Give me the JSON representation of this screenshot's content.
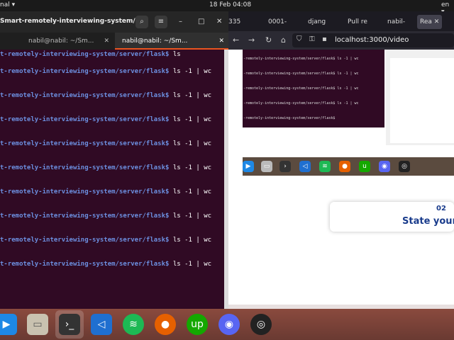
{
  "topbar": {
    "app": "nal ▾",
    "clock": "18 Feb 04:08",
    "lang": "en ▾"
  },
  "terminal": {
    "title": "Smart-remotely-interviewing-system/...",
    "tabs": [
      {
        "label": "nabil@nabil: ~/Sm..."
      },
      {
        "label": "nabil@nabil: ~/Sm..."
      }
    ],
    "prompt_path": "t-remotely-interviewing-system/server/flask$",
    "lines": [
      " ls",
      " ls -1 | wc",
      " ls -1 | wc",
      " ls -1 | wc",
      " ls -1 | wc",
      " ls -1 | wc",
      " ls -1 | wc",
      " ls -1 | wc",
      " ls -1 | wc",
      " ls -1 | wc"
    ]
  },
  "browser": {
    "tabs": [
      "335",
      "0001-",
      "djang",
      "Pull re",
      "nabil-",
      "Rea"
    ],
    "url": "localhost:3000/video",
    "embed_lines": [
      "-remotely-interviewing-system/server/flask$ ls -1 | wc",
      "-remotely-interviewing-system/server/flask$ ls -1 | wc",
      "-remotely-interviewing-system/server/flask$ ls -1 | wc",
      "-remotely-interviewing-system/server/flask$ ls -1 | wc",
      "-remotely-interviewing-system/server/flask$"
    ],
    "card": {
      "number": "02",
      "text": "State your"
    }
  }
}
